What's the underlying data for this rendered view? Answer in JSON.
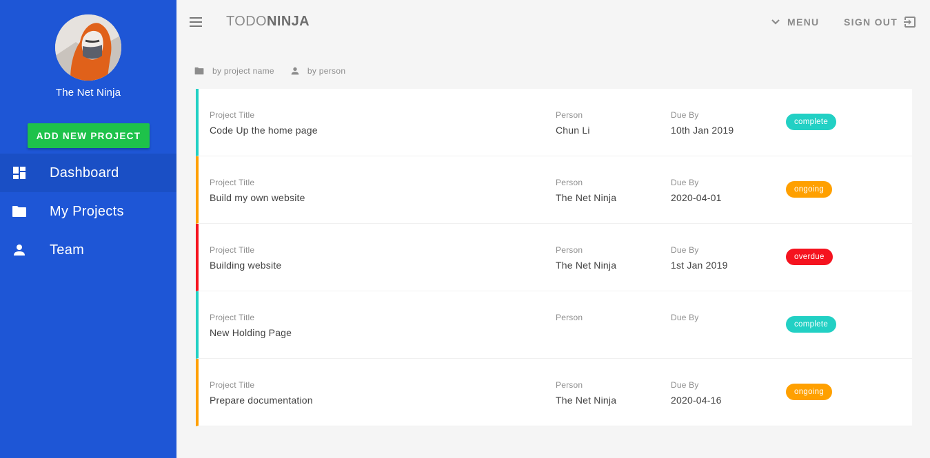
{
  "sidebar": {
    "user_name": "The Net Ninja",
    "add_project_label": "ADD NEW PROJECT",
    "items": [
      {
        "label": "Dashboard",
        "icon": "dashboard-icon"
      },
      {
        "label": "My Projects",
        "icon": "folder-icon"
      },
      {
        "label": "Team",
        "icon": "person-icon"
      }
    ]
  },
  "toolbar": {
    "brand_light": "TODO",
    "brand_bold": "NINJA",
    "menu_label": "MENU",
    "signout_label": "SIGN OUT"
  },
  "sort": {
    "by_project_label": "by project name",
    "by_person_label": "by person"
  },
  "columns": {
    "title": "Project Title",
    "person": "Person",
    "due": "Due By"
  },
  "projects": [
    {
      "title": "Code Up the home page",
      "person": "Chun Li",
      "due": "10th Jan 2019",
      "status": "complete"
    },
    {
      "title": "Build my own website",
      "person": "The Net Ninja",
      "due": "2020-04-01",
      "status": "ongoing"
    },
    {
      "title": "Building website",
      "person": "The Net Ninja",
      "due": "1st Jan 2019",
      "status": "overdue"
    },
    {
      "title": "New Holding Page",
      "person": "",
      "due": "",
      "status": "complete"
    },
    {
      "title": "Prepare documentation",
      "person": "The Net Ninja",
      "due": "2020-04-16",
      "status": "ongoing"
    }
  ],
  "colors": {
    "sidebar": "#1e56d6",
    "add_button": "#1ec24a",
    "complete": "#22d0c4",
    "ongoing": "#ffa000",
    "overdue": "#f5131f"
  }
}
